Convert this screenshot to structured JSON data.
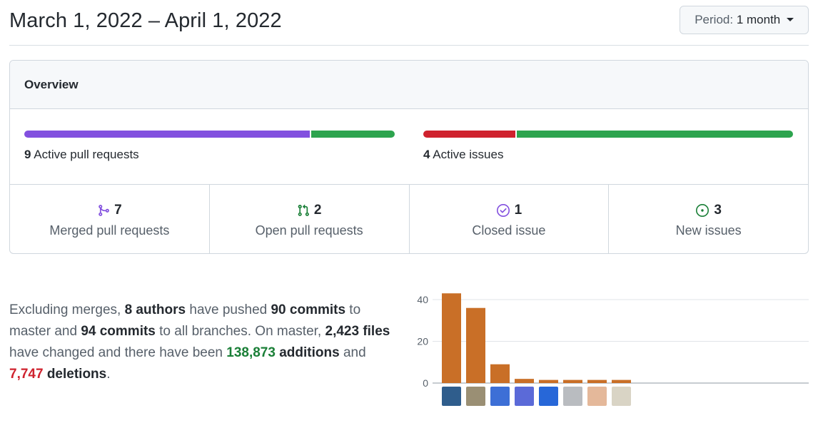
{
  "header": {
    "date_range": "March 1, 2022 – April 1, 2022",
    "period_label": "Period:",
    "period_value": "1 month"
  },
  "overview": {
    "title": "Overview",
    "pull_requests": {
      "count": "9",
      "label": "Active pull requests",
      "merged_fraction": 0.774,
      "open_fraction": 0.226,
      "merged_color": "#8250df",
      "open_color": "#2da44e"
    },
    "issues": {
      "count": "4",
      "label": "Active issues",
      "closed_fraction": 0.25,
      "new_fraction": 0.75,
      "closed_color": "#cf222e",
      "new_color": "#2da44e"
    },
    "stats": [
      {
        "icon": "git-merge-icon",
        "value": "7",
        "label": "Merged pull requests",
        "color": "#8250df"
      },
      {
        "icon": "git-pull-request-icon",
        "value": "2",
        "label": "Open pull requests",
        "color": "#1a7f37"
      },
      {
        "icon": "issue-closed-icon",
        "value": "1",
        "label": "Closed issue",
        "color": "#8250df"
      },
      {
        "icon": "issue-opened-icon",
        "value": "3",
        "label": "New issues",
        "color": "#1a7f37"
      }
    ]
  },
  "summary": {
    "t1": "Excluding merges, ",
    "authors": "8 authors",
    "t2": " have pushed ",
    "commits_master": "90 commits",
    "t3": " to master and ",
    "commits_all": "94 commits",
    "t4": " to all branches. On master, ",
    "files": "2,423 files",
    "t5": " have changed and there have been ",
    "additions_num": "138,873",
    "additions_word": " additions",
    "t6": " and ",
    "deletions_num": "7,747",
    "deletions_word": " deletions",
    "t7": "."
  },
  "chart_data": {
    "type": "bar",
    "categories": [
      "contributor-1",
      "contributor-2",
      "contributor-3",
      "contributor-4",
      "contributor-5",
      "contributor-6",
      "contributor-7",
      "contributor-8"
    ],
    "values": [
      43,
      36,
      9,
      2,
      1.5,
      1.5,
      1.5,
      1.5
    ],
    "ylim": [
      0,
      45
    ],
    "yticks": [
      0,
      20,
      40
    ],
    "grid": true,
    "bar_color": "#c96f27",
    "title": "",
    "xlabel": "",
    "ylabel": ""
  }
}
